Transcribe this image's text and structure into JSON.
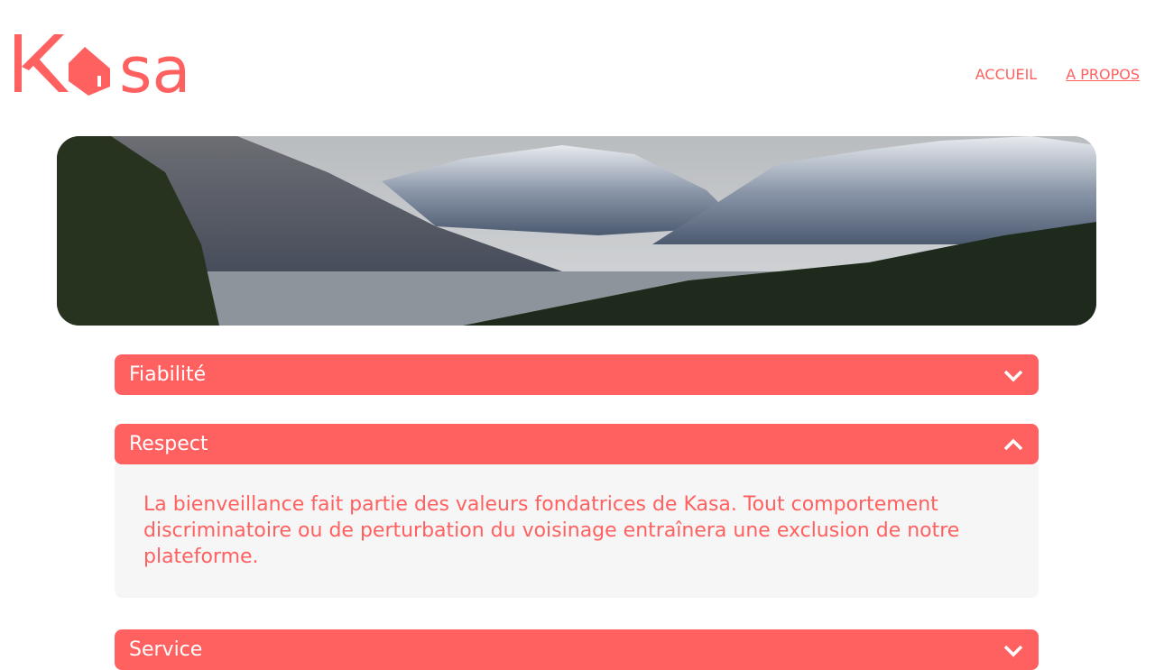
{
  "header": {
    "logo_text": "Kasa",
    "nav": [
      {
        "label": "ACCUEIL",
        "active": false
      },
      {
        "label": "A PROPOS",
        "active": true
      }
    ]
  },
  "accordion": [
    {
      "title": "Fiabilité",
      "open": false
    },
    {
      "title": "Respect",
      "open": true,
      "content": "La bienveillance fait partie des valeurs fondatrices de Kasa. Tout comportement discriminatoire ou de perturbation du voisinage entraînera une exclusion de notre plateforme."
    },
    {
      "title": "Service",
      "open": false
    }
  ],
  "colors": {
    "brand": "#FF6060",
    "panel": "#F6F6F6"
  }
}
